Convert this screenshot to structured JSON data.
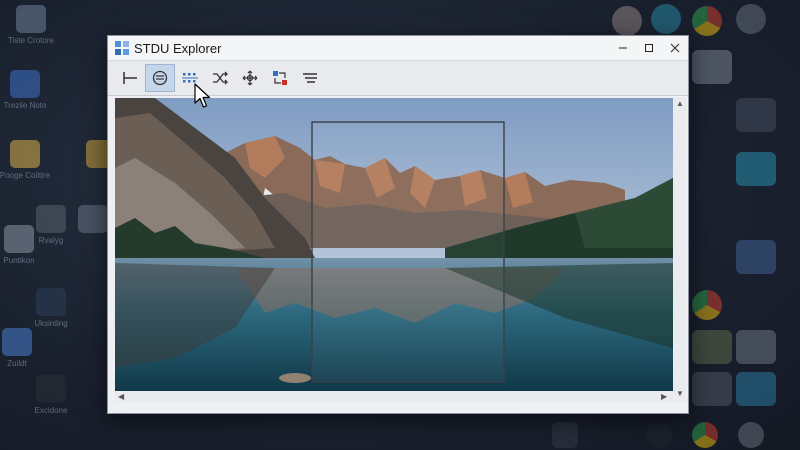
{
  "window": {
    "title": "STDU Explorer"
  },
  "toolbar": {
    "buttons": [
      {
        "name": "first-page-icon"
      },
      {
        "name": "fit-page-icon"
      },
      {
        "name": "grid-view-icon"
      },
      {
        "name": "shuffle-icon"
      },
      {
        "name": "move-icon"
      },
      {
        "name": "layout-icon"
      },
      {
        "name": "list-icon"
      }
    ],
    "active": "grid-view-icon"
  },
  "desktop": {
    "left_icons": [
      "Tiste Crotore",
      "Trezile Noto",
      "Pooge Coiltire",
      "Rvalyg",
      "Puntikon",
      "Uksirding",
      "Zuildt",
      "Excidone"
    ]
  },
  "colors": {
    "accent": "#c6d6ea",
    "desktop_bg": "#1b2230",
    "titlebar": "#f4f5f7"
  }
}
